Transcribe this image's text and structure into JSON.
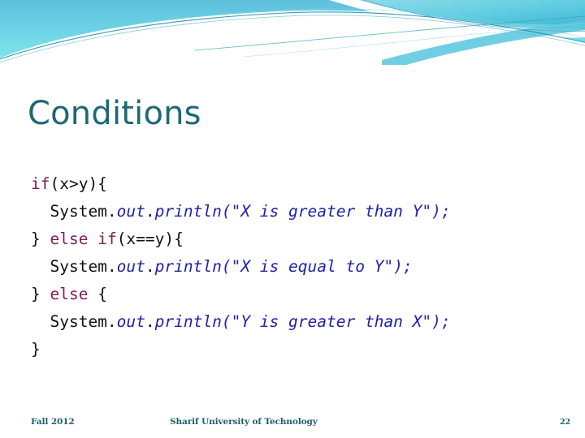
{
  "slide": {
    "title": "Conditions",
    "page_number": "22",
    "theme": {
      "title_color": "#1d6878",
      "band_top_color": "#63c3de",
      "band_bottom_color": "#79e3ea",
      "accent_teal": "#1d9aa8",
      "keyword_color": "#7c1f56",
      "member_color": "#2222a8",
      "string_color": "#2222a8",
      "plain_color": "#111111",
      "footer_color": "#1d5f6c",
      "background_color": "#ffffff"
    }
  },
  "code": {
    "language": "java",
    "lines": [
      {
        "indent": 0,
        "tokens": [
          {
            "kind": "keyword",
            "text": "if"
          },
          {
            "kind": "plain",
            "text": "(x>y){"
          }
        ]
      },
      {
        "indent": 1,
        "tokens": [
          {
            "kind": "plain",
            "text": "System."
          },
          {
            "kind": "member",
            "text": "out"
          },
          {
            "kind": "plain",
            "text": "."
          },
          {
            "kind": "member",
            "text": "println"
          },
          {
            "kind": "string",
            "text": "(\"X is greater than Y\");"
          }
        ]
      },
      {
        "indent": 0,
        "tokens": [
          {
            "kind": "plain",
            "text": "} "
          },
          {
            "kind": "keyword",
            "text": "else"
          },
          {
            "kind": "plain",
            "text": " "
          },
          {
            "kind": "keyword",
            "text": "if"
          },
          {
            "kind": "plain",
            "text": "(x==y){"
          }
        ]
      },
      {
        "indent": 1,
        "tokens": [
          {
            "kind": "plain",
            "text": "System."
          },
          {
            "kind": "member",
            "text": "out"
          },
          {
            "kind": "plain",
            "text": "."
          },
          {
            "kind": "member",
            "text": "println"
          },
          {
            "kind": "string",
            "text": "(\"X is equal to Y\");"
          }
        ]
      },
      {
        "indent": 0,
        "tokens": [
          {
            "kind": "plain",
            "text": "} "
          },
          {
            "kind": "keyword",
            "text": "else"
          },
          {
            "kind": "plain",
            "text": " {"
          }
        ]
      },
      {
        "indent": 1,
        "tokens": [
          {
            "kind": "plain",
            "text": "System."
          },
          {
            "kind": "member",
            "text": "out"
          },
          {
            "kind": "plain",
            "text": "."
          },
          {
            "kind": "member",
            "text": "println"
          },
          {
            "kind": "string",
            "text": "(\"Y is greater than X\");"
          }
        ]
      },
      {
        "indent": 0,
        "tokens": [
          {
            "kind": "plain",
            "text": "}"
          }
        ]
      }
    ]
  },
  "footer": {
    "term": "Fall 2012",
    "organization": "Sharif University of Technology",
    "page_number": "22"
  }
}
